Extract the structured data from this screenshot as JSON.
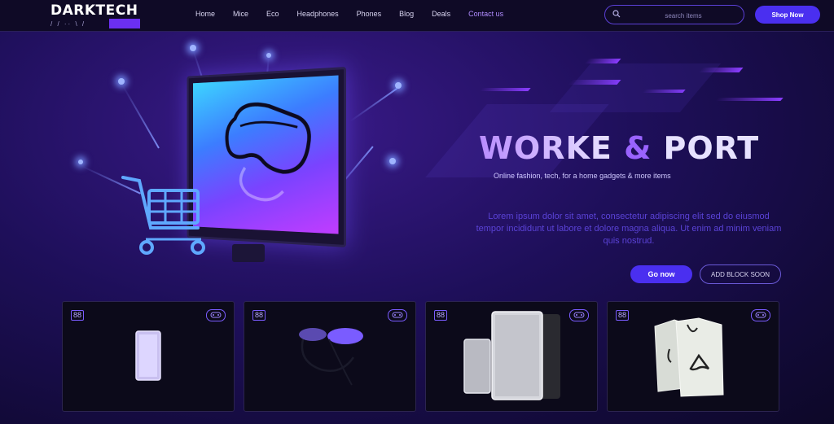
{
  "header": {
    "logo_text": "DARKTECH",
    "logo_sub": "/ / ·· \\ /",
    "nav": [
      {
        "label": "Home",
        "active": false
      },
      {
        "label": "Mice",
        "active": false
      },
      {
        "label": "Eco",
        "active": false
      },
      {
        "label": "Headphones",
        "active": false
      },
      {
        "label": "Phones",
        "active": false
      },
      {
        "label": "Blog",
        "active": false
      },
      {
        "label": "Deals",
        "active": false
      },
      {
        "label": "Contact us",
        "active": true
      }
    ],
    "search_placeholder": "search items",
    "cta_label": "Shop Now"
  },
  "hero": {
    "title_part1": "WORKE",
    "title_amp": "&",
    "title_part2": "PORT",
    "subtitle": "Online fashion, tech, for a home gadgets & more items",
    "body": "Lorem ipsum dolor sit amet, consectetur adipiscing elit sed do eiusmod tempor incididunt ut labore et dolore magna aliqua. Ut enim ad minim veniam quis nostrud.",
    "primary_label": "Go now",
    "secondary_label": "ADD BLOCK SOON"
  },
  "cards": [
    {
      "tag": "88",
      "product": "phone"
    },
    {
      "tag": "88",
      "product": "vr-headset"
    },
    {
      "tag": "88",
      "product": "tablets"
    },
    {
      "tag": "88",
      "product": "apparel"
    }
  ],
  "colors": {
    "accent": "#4a2ff0",
    "accent_light": "#b08cff",
    "header_bg": "#0f0a26",
    "card_bg": "#0c0a1a"
  }
}
